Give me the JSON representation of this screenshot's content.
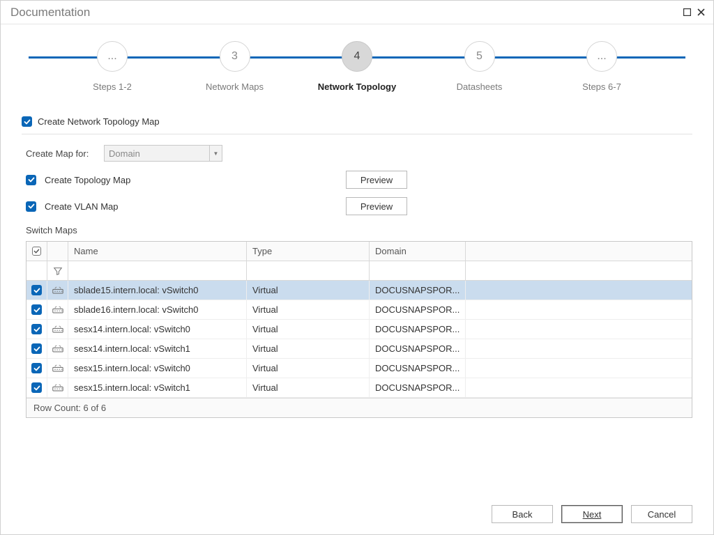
{
  "window": {
    "title": "Documentation"
  },
  "stepper": {
    "steps": [
      {
        "num": "...",
        "label": "Steps 1-2",
        "active": false
      },
      {
        "num": "3",
        "label": "Network Maps",
        "active": false
      },
      {
        "num": "4",
        "label": "Network Topology",
        "active": true
      },
      {
        "num": "5",
        "label": "Datasheets",
        "active": false
      },
      {
        "num": "...",
        "label": "Steps 6-7",
        "active": false
      }
    ]
  },
  "form": {
    "create_topology_map_master": "Create Network Topology Map",
    "create_map_for_label": "Create Map for:",
    "create_map_for_value": "Domain",
    "create_topology_map": "Create Topology Map",
    "create_vlan_map": "Create VLAN Map",
    "preview_label": "Preview"
  },
  "table": {
    "label": "Switch Maps",
    "columns": {
      "name": "Name",
      "type": "Type",
      "domain": "Domain"
    },
    "rows": [
      {
        "checked": true,
        "name": "sblade15.intern.local: vSwitch0",
        "type": "Virtual",
        "domain": "DOCUSNAPSPOR...",
        "selected": true
      },
      {
        "checked": true,
        "name": "sblade16.intern.local: vSwitch0",
        "type": "Virtual",
        "domain": "DOCUSNAPSPOR...",
        "selected": false
      },
      {
        "checked": true,
        "name": "sesx14.intern.local: vSwitch0",
        "type": "Virtual",
        "domain": "DOCUSNAPSPOR...",
        "selected": false
      },
      {
        "checked": true,
        "name": "sesx14.intern.local: vSwitch1",
        "type": "Virtual",
        "domain": "DOCUSNAPSPOR...",
        "selected": false
      },
      {
        "checked": true,
        "name": "sesx15.intern.local: vSwitch0",
        "type": "Virtual",
        "domain": "DOCUSNAPSPOR...",
        "selected": false
      },
      {
        "checked": true,
        "name": "sesx15.intern.local: vSwitch1",
        "type": "Virtual",
        "domain": "DOCUSNAPSPOR...",
        "selected": false
      }
    ],
    "footer": "Row Count: 6 of 6"
  },
  "buttons": {
    "back": "Back",
    "next": "Next",
    "cancel": "Cancel"
  }
}
